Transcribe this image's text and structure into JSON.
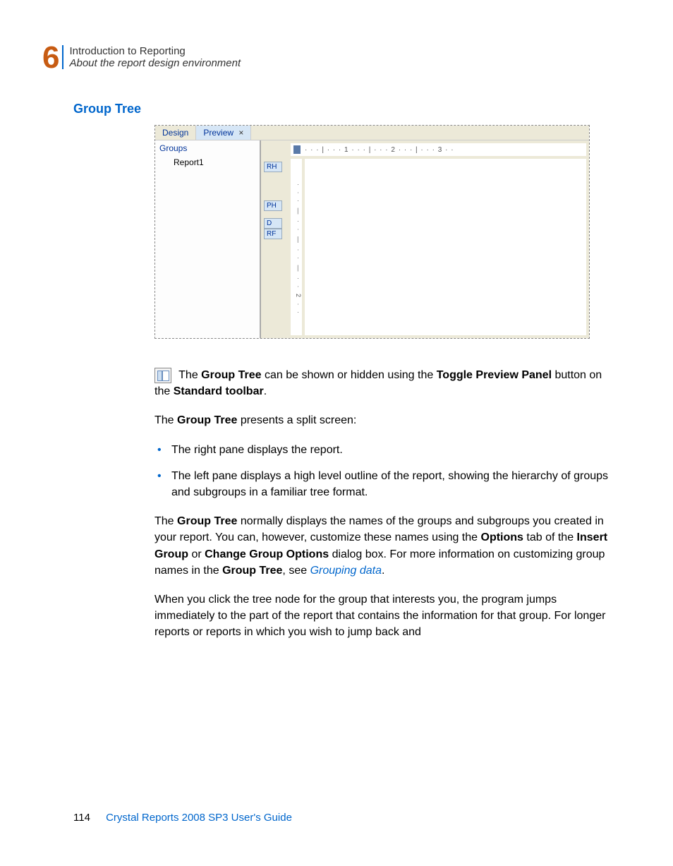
{
  "header": {
    "chapter_number": "6",
    "title": "Introduction to Reporting",
    "subtitle": "About the report design environment"
  },
  "section_heading": "Group Tree",
  "screenshot": {
    "tabs": {
      "design": "Design",
      "preview": "Preview",
      "close_glyph": "×"
    },
    "groups_label": "Groups",
    "report_name": "Report1",
    "ruler_h": "·  ·  ·  |  ·  ·  ·  1  ·  ·  ·  |  ·  ·  ·  2  ·  ·  ·  |  ·  ·  ·  3  ·  ·",
    "ruler_v": "·  ·  ·  —  ·  ·  —  ·  ·  —  ·  ·  2  ·  ·",
    "sections": {
      "rh": "RH",
      "ph": "PH",
      "d": "D",
      "rf": "RF"
    }
  },
  "body": {
    "p1_prefix": " The ",
    "p1_b1": "Group Tree",
    "p1_mid1": " can be shown or hidden using the ",
    "p1_b2": "Toggle Preview Panel",
    "p1_mid2": " button on the ",
    "p1_b3": "Standard toolbar",
    "p1_end": ".",
    "p2_prefix": "The ",
    "p2_b1": "Group Tree",
    "p2_suffix": " presents a split screen:",
    "bullets": {
      "b1": "The right pane displays the report.",
      "b2": "The left pane displays a high level outline of the report, showing the hierarchy of groups and subgroups in a familiar tree format."
    },
    "p3_prefix": "The ",
    "p3_b1": "Group Tree",
    "p3_mid1": " normally displays the names of the groups and subgroups you created in your report. You can, however, customize these names using the ",
    "p3_b2": "Options",
    "p3_mid2": " tab of the ",
    "p3_b3": "Insert Group",
    "p3_mid3": " or ",
    "p3_b4": "Change Group Options",
    "p3_mid4": " dialog box. For more information on customizing group names in the ",
    "p3_b5": "Group Tree",
    "p3_mid5": ", see ",
    "p3_link": "Grouping data",
    "p3_end": ".",
    "p4": "When you click the tree node for the group that interests you, the program jumps immediately to the part of the report that contains the information for that group. For longer reports or reports in which you wish to jump back and"
  },
  "footer": {
    "page_number": "114",
    "book_title": "Crystal Reports 2008 SP3 User's Guide"
  }
}
